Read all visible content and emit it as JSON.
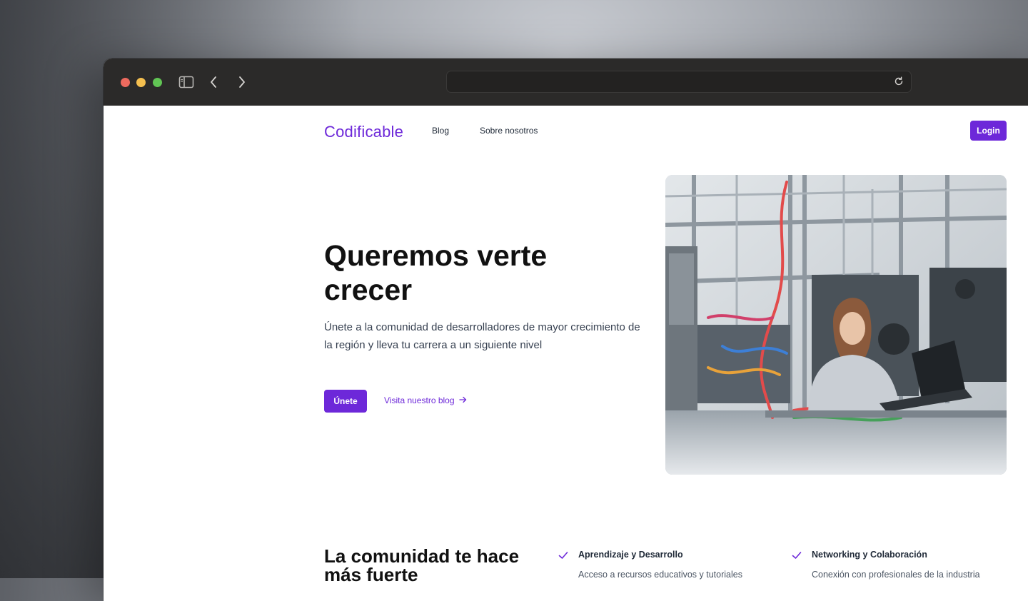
{
  "nav": {
    "brand": "Codificable",
    "links": [
      "Blog",
      "Sobre nosotros"
    ],
    "login": "Login"
  },
  "hero": {
    "title": "Queremos verte crecer",
    "subtitle": "Únete a la comunidad de desarrolladores de mayor crecimiento de la región y lleva tu carrera a un siguiente nivel",
    "primary_button": "Únete",
    "secondary_link": "Visita nuestro blog"
  },
  "community": {
    "title": "La comunidad te hace más fuerte",
    "features": [
      {
        "title": "Aprendizaje y Desarrollo",
        "description": "Acceso a recursos educativos y tutoriales"
      },
      {
        "title": "Networking y Colaboración",
        "description": "Conexión con profesionales de la industria"
      }
    ]
  },
  "colors": {
    "accent": "#6d28d9",
    "titlebar": "#2b2a29",
    "traffic_red": "#ed6a5e",
    "traffic_yellow": "#f4bf4f",
    "traffic_green": "#61c554"
  },
  "icons": [
    "sidebar-icon",
    "back-icon",
    "forward-icon",
    "reload-icon",
    "arrow-right-icon",
    "check-icon"
  ]
}
